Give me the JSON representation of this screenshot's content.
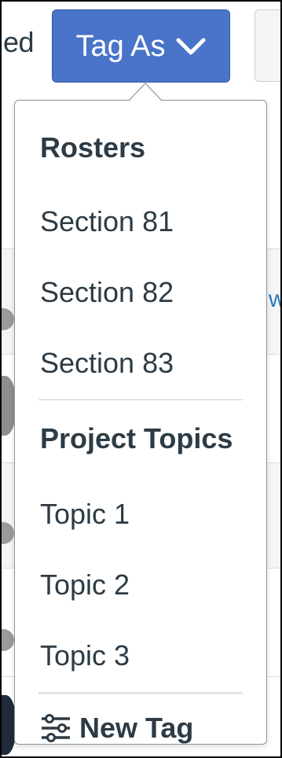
{
  "background": {
    "partial_text": "ed",
    "partial_link": "w"
  },
  "tag_button": {
    "label": "Tag As",
    "icon": "chevron-down-icon",
    "color": "#4a74c9"
  },
  "menu": {
    "sections": [
      {
        "heading": "Rosters",
        "items": [
          "Section 81",
          "Section 82",
          "Section 83"
        ]
      },
      {
        "heading": "Project Topics",
        "items": [
          "Topic 1",
          "Topic 2",
          "Topic 3"
        ]
      }
    ],
    "new_tag": {
      "label": "New Tag",
      "icon": "sliders-icon"
    }
  }
}
